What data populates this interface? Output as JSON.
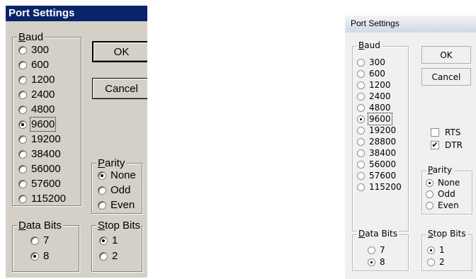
{
  "left_dialog": {
    "title": "Port Settings",
    "baud": {
      "legend_accel": "B",
      "legend_rest": "aud",
      "options": [
        {
          "label": "300",
          "selected": false
        },
        {
          "label": "600",
          "selected": false
        },
        {
          "label": "1200",
          "selected": false
        },
        {
          "label": "2400",
          "selected": false
        },
        {
          "label": "4800",
          "selected": false
        },
        {
          "label": "9600",
          "selected": true
        },
        {
          "label": "19200",
          "selected": false
        },
        {
          "label": "38400",
          "selected": false
        },
        {
          "label": "56000",
          "selected": false
        },
        {
          "label": "57600",
          "selected": false
        },
        {
          "label": "115200",
          "selected": false
        }
      ]
    },
    "buttons": {
      "ok": "OK",
      "cancel": "Cancel"
    },
    "parity": {
      "legend_accel": "P",
      "legend_rest": "arity",
      "options": [
        {
          "label": "None",
          "selected": true
        },
        {
          "label": "Odd",
          "selected": false
        },
        {
          "label": "Even",
          "selected": false
        }
      ]
    },
    "data_bits": {
      "legend_accel": "D",
      "legend_rest": "ata Bits",
      "options": [
        {
          "label": "7",
          "selected": false
        },
        {
          "label": "8",
          "selected": true
        }
      ]
    },
    "stop_bits": {
      "legend_accel": "S",
      "legend_rest": "top Bits",
      "options": [
        {
          "label": "1",
          "selected": true
        },
        {
          "label": "2",
          "selected": false
        }
      ]
    }
  },
  "right_dialog": {
    "title": "Port Settings",
    "baud": {
      "legend_accel": "B",
      "legend_rest": "aud",
      "options": [
        {
          "label": "300",
          "selected": false
        },
        {
          "label": "600",
          "selected": false
        },
        {
          "label": "1200",
          "selected": false
        },
        {
          "label": "2400",
          "selected": false
        },
        {
          "label": "4800",
          "selected": false
        },
        {
          "label": "9600",
          "selected": true
        },
        {
          "label": "19200",
          "selected": false
        },
        {
          "label": "28800",
          "selected": false
        },
        {
          "label": "38400",
          "selected": false
        },
        {
          "label": "56000",
          "selected": false
        },
        {
          "label": "57600",
          "selected": false
        },
        {
          "label": "115200",
          "selected": false
        }
      ]
    },
    "buttons": {
      "ok": "OK",
      "cancel": "Cancel"
    },
    "rts": {
      "label": "RTS",
      "checked": false
    },
    "dtr": {
      "label": "DTR",
      "checked": true,
      "mark": "✔"
    },
    "parity": {
      "legend_accel": "P",
      "legend_rest": "arity",
      "options": [
        {
          "label": "None",
          "selected": true
        },
        {
          "label": "Odd",
          "selected": false
        },
        {
          "label": "Even",
          "selected": false
        }
      ]
    },
    "data_bits": {
      "legend_accel": "D",
      "legend_rest": "ata Bits",
      "options": [
        {
          "label": "7",
          "selected": false
        },
        {
          "label": "8",
          "selected": true
        }
      ]
    },
    "stop_bits": {
      "legend_accel": "S",
      "legend_rest": "top Bits",
      "options": [
        {
          "label": "1",
          "selected": true
        },
        {
          "label": "2",
          "selected": false
        }
      ]
    }
  }
}
